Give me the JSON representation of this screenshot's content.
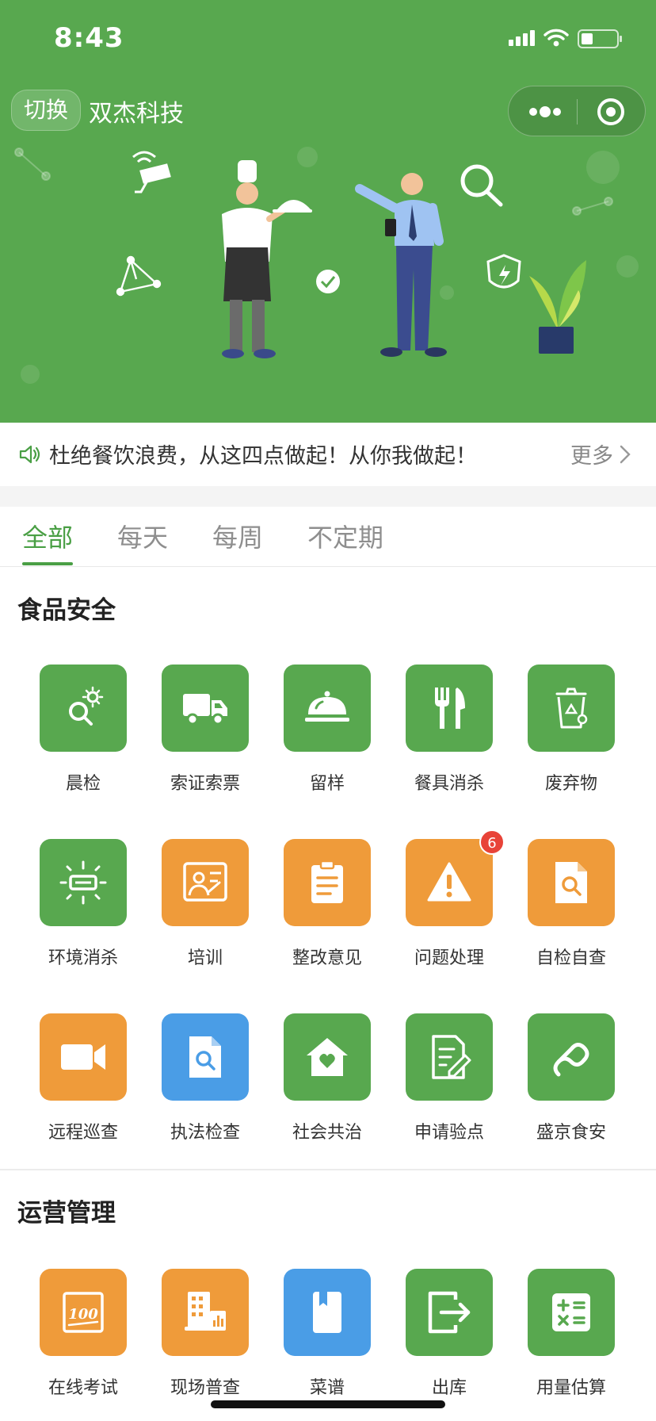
{
  "status_bar": {
    "time": "8:43"
  },
  "header": {
    "switch_label": "切换",
    "company_name": "双杰科技",
    "capsule": {
      "more_icon": "more-dots-icon",
      "close_icon": "target-circle-icon"
    }
  },
  "notice": {
    "text": "杜绝餐饮浪费，从这四点做起！从你我做起！",
    "more_label": "更多"
  },
  "tabs": [
    {
      "label": "全部",
      "active": true
    },
    {
      "label": "每天",
      "active": false
    },
    {
      "label": "每周",
      "active": false
    },
    {
      "label": "不定期",
      "active": false
    }
  ],
  "sections": [
    {
      "title": "食品安全",
      "items": [
        {
          "label": "晨检",
          "icon": "morning-check-icon",
          "color": "#58a84f"
        },
        {
          "label": "索证索票",
          "icon": "truck-icon",
          "color": "#58a84f"
        },
        {
          "label": "留样",
          "icon": "food-cloche-icon",
          "color": "#58a84f"
        },
        {
          "label": "餐具消杀",
          "icon": "fork-knife-icon",
          "color": "#58a84f"
        },
        {
          "label": "废弃物",
          "icon": "recycle-bin-icon",
          "color": "#58a84f"
        },
        {
          "label": "环境消杀",
          "icon": "uv-lamp-icon",
          "color": "#58a84f"
        },
        {
          "label": "培训",
          "icon": "training-board-icon",
          "color": "#ef9b3a"
        },
        {
          "label": "整改意见",
          "icon": "clipboard-icon",
          "color": "#ef9b3a"
        },
        {
          "label": "问题处理",
          "icon": "warning-icon",
          "color": "#ef9b3a",
          "badge": "6"
        },
        {
          "label": "自检自查",
          "icon": "document-search-icon",
          "color": "#ef9b3a"
        },
        {
          "label": "远程巡查",
          "icon": "video-camera-icon",
          "color": "#ef9b3a"
        },
        {
          "label": "执法检查",
          "icon": "file-search-icon",
          "color": "#4a9de6"
        },
        {
          "label": "社会共治",
          "icon": "home-heart-icon",
          "color": "#58a84f"
        },
        {
          "label": "申请验点",
          "icon": "edit-document-icon",
          "color": "#58a84f"
        },
        {
          "label": "盛京食安",
          "icon": "link-s-icon",
          "color": "#58a84f"
        }
      ]
    },
    {
      "title": "运营管理",
      "items": [
        {
          "label": "在线考试",
          "icon": "exam-100-icon",
          "color": "#ef9b3a"
        },
        {
          "label": "现场普查",
          "icon": "building-chart-icon",
          "color": "#ef9b3a"
        },
        {
          "label": "菜谱",
          "icon": "recipe-book-icon",
          "color": "#4a9de6"
        },
        {
          "label": "出库",
          "icon": "exit-arrow-icon",
          "color": "#58a84f"
        },
        {
          "label": "用量估算",
          "icon": "calculator-icon",
          "color": "#58a84f"
        }
      ]
    }
  ]
}
